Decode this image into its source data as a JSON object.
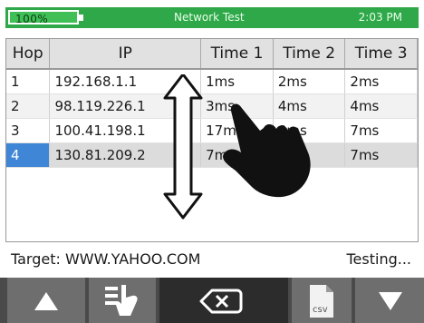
{
  "status_bar": {
    "battery": "100%",
    "title": "Network Test",
    "time": "2:03 PM",
    "color": "#2fa84a"
  },
  "table": {
    "columns": [
      "Hop",
      "IP",
      "Time 1",
      "Time 2",
      "Time 3"
    ],
    "rows": [
      [
        "1",
        "192.168.1.1",
        "1ms",
        "2ms",
        "2ms"
      ],
      [
        "2",
        "98.119.226.1",
        "3ms",
        "4ms",
        "4ms"
      ],
      [
        "3",
        "100.41.198.1",
        "17ms",
        "8ms",
        "7ms"
      ],
      [
        "4",
        "130.81.209.2",
        "7ms",
        "7ms",
        "7ms"
      ]
    ],
    "selected_hop": "4",
    "selection_color": "#3f86d6"
  },
  "footer": {
    "target": "Target: WWW.YAHOO.COM",
    "state": "Testing..."
  },
  "toolbar": {
    "buttons": [
      {
        "icon": "up-arrow-icon"
      },
      {
        "icon": "hand-list-icon"
      },
      {
        "icon": "backspace-icon"
      },
      {
        "icon": "csv-file-icon",
        "label": "csv"
      },
      {
        "icon": "down-arrow-icon"
      }
    ]
  }
}
